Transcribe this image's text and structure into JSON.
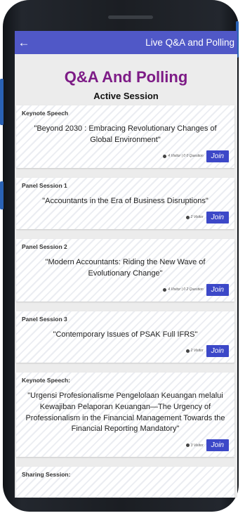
{
  "app_bar": {
    "back_icon": "arrow-left-icon",
    "title": "Live Q&A and Polling"
  },
  "page": {
    "heading": "Q&A And Polling",
    "subheading": "Active Session"
  },
  "sessions": [
    {
      "type": "Keynote Speech",
      "title": "\"Beyond 2030 : Embracing Revolutionary Changes of Global Environment\"",
      "stats": "4 Visitor | 0 0 Question",
      "join_label": "Join"
    },
    {
      "type": "Panel Session 1",
      "title": "\"Accountants in the Era of Business Disruptions\"",
      "stats": "2 Visitor",
      "join_label": "Join"
    },
    {
      "type": "Panel Session 2",
      "title": "\"Modern Accountants: Riding the New Wave of Evolutionary Change\"",
      "stats": "4 Visitor | 0 2 Question",
      "join_label": "Join"
    },
    {
      "type": "Panel Session 3",
      "title": "\"Contemporary Issues of PSAK Full IFRS\"",
      "stats": "2 Visitor",
      "join_label": "Join"
    },
    {
      "type": "Keynote Speech:",
      "title": "\"Urgensi Profesionalisme Pengelolaan Keuangan melalui Kewajiban Pelaporan Keuangan—The Urgency of Professionalism in the Financial Management Towards the Financial Reporting Mandatory\"",
      "stats": "3 Visitor",
      "join_label": "Join"
    },
    {
      "type": "Sharing Session:",
      "title": "",
      "stats": "",
      "join_label": ""
    }
  ],
  "colors": {
    "app_bar": "#5058c7",
    "heading": "#7d1b86",
    "join_button": "#3c48c8"
  }
}
